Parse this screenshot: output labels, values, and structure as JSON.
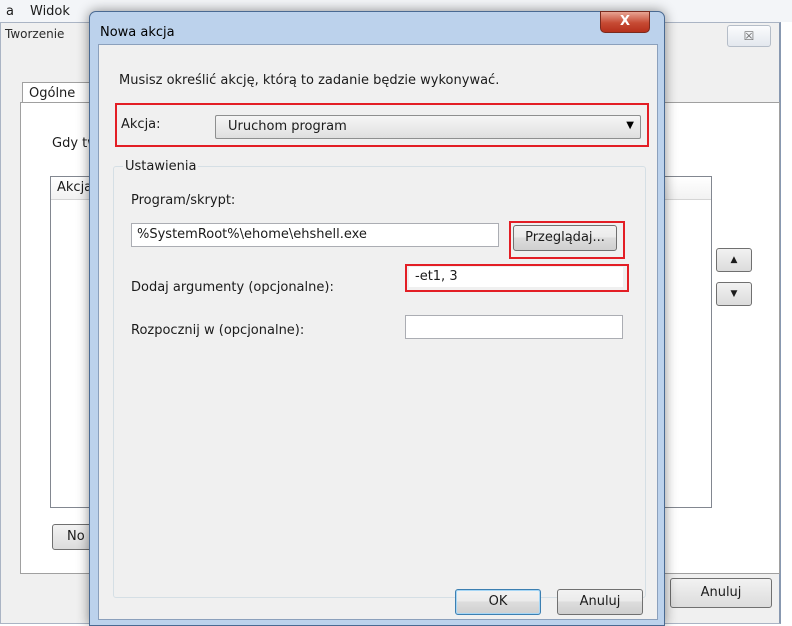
{
  "menubar": {
    "items": [
      "a",
      "Widok"
    ]
  },
  "background_window": {
    "title": "Tworzenie",
    "close_glyph": "☒",
    "tab_label": "Ogólne",
    "text_fragment": "Gdy tw",
    "list_header": "Akcja",
    "new_button_label": "No",
    "cancel_button_label": "Anuluj",
    "move_up_glyph": "▲",
    "move_down_glyph": "▼"
  },
  "dialog": {
    "title": "Nowa akcja",
    "close_glyph": "X",
    "instruction": "Musisz określić akcję, którą to zadanie będzie wykonywać.",
    "action": {
      "label": "Akcja:",
      "selected": "Uruchom program",
      "arrow_glyph": "▼"
    },
    "settings": {
      "legend": "Ustawienia",
      "program_label": "Program/skrypt:",
      "program_value": "%SystemRoot%\\ehome\\ehshell.exe",
      "browse_label": "Przeglądaj...",
      "arguments_label": "Dodaj argumenty (opcjonalne):",
      "arguments_value": "-et1, 3",
      "start_in_label": "Rozpocznij w (opcjonalne):",
      "start_in_value": ""
    },
    "ok_label": "OK",
    "cancel_label": "Anuluj"
  },
  "colors": {
    "highlight": "#e31e25",
    "dialog_frame": "#bcd2ec",
    "close_button": "#c64a33"
  }
}
